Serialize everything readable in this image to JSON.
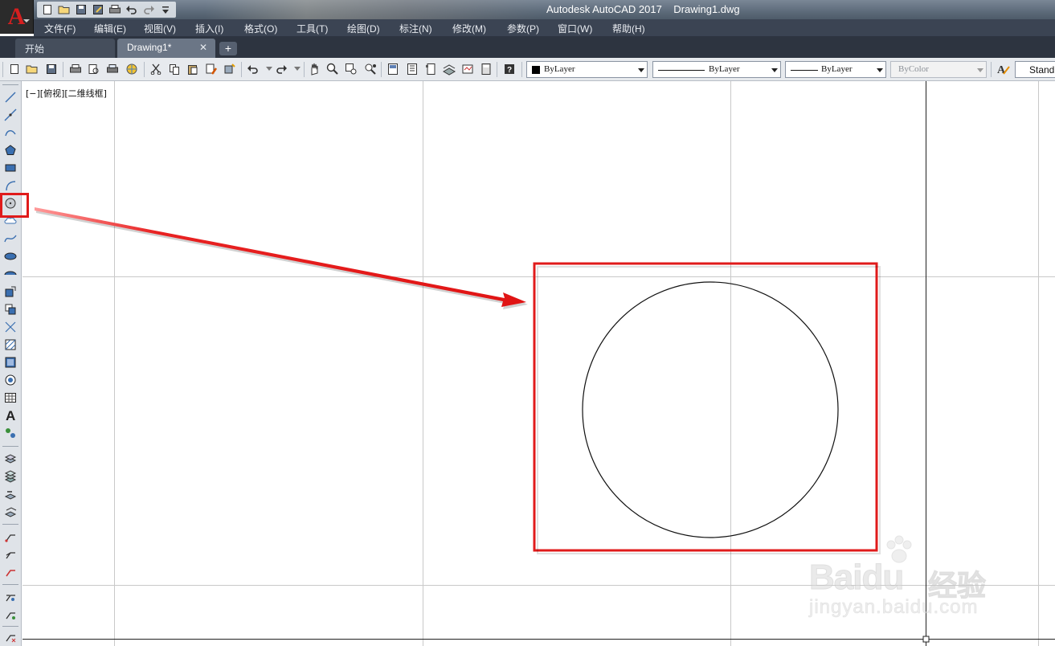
{
  "window": {
    "title": "Autodesk AutoCAD 2017    Drawing1.dwg",
    "logo_letter": "A",
    "accent_color": "#e21b1b"
  },
  "qat_icons": [
    "new-icon",
    "open-icon",
    "save-icon",
    "saveas-icon",
    "plot-icon",
    "undo-icon",
    "redo-icon",
    "customize-icon"
  ],
  "menu": [
    "文件(F)",
    "编辑(E)",
    "视图(V)",
    "插入(I)",
    "格式(O)",
    "工具(T)",
    "绘图(D)",
    "标注(N)",
    "修改(M)",
    "参数(P)",
    "窗口(W)",
    "帮助(H)"
  ],
  "tabs": {
    "start": "开始",
    "drawing": "Drawing1*",
    "close": "✕",
    "add": "+"
  },
  "toolbar": {
    "color_combo": "ByLayer",
    "linetype_combo": "ByLayer",
    "lineweight_combo": "ByLayer",
    "plotstyle_combo": "ByColor",
    "text_style_combo": "Stand"
  },
  "canvas": {
    "view_label": "[−][俯视][二维线框]"
  },
  "annotations": {
    "highlight_color": "#e01b1b"
  },
  "watermark": {
    "brand": "Bai",
    "brand2": "du",
    "cn": "经验",
    "url": "jingyan.baidu.com"
  }
}
